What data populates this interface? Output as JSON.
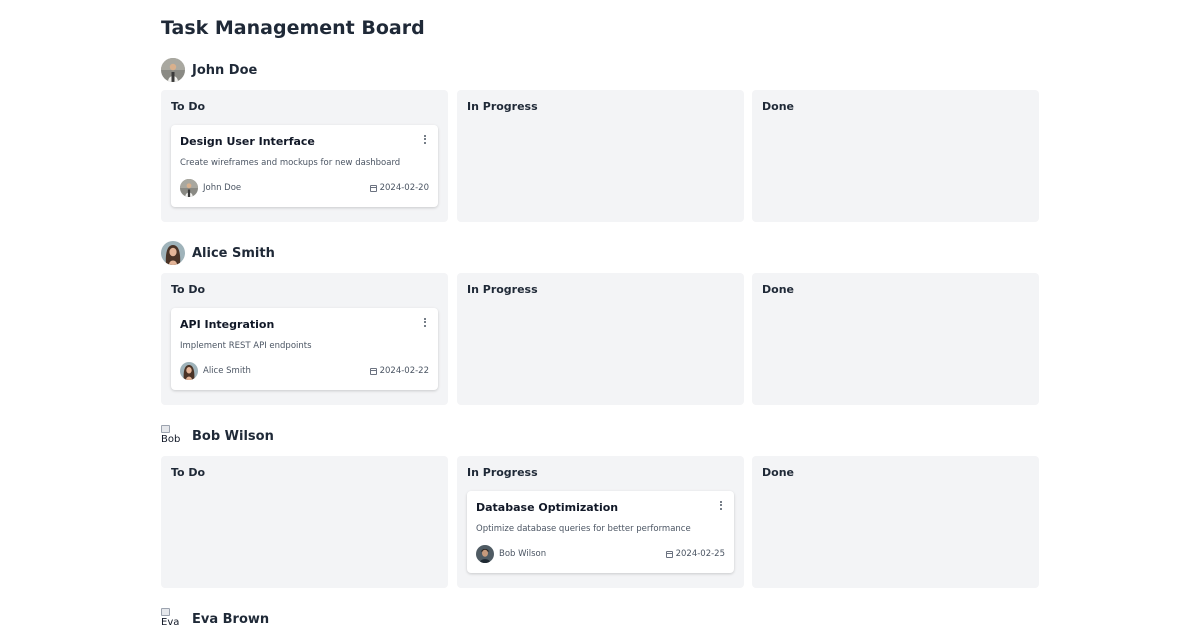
{
  "board": {
    "title": "Task Management Board"
  },
  "users": [
    {
      "name": "John Doe",
      "avatar": "person-photo-bald-man",
      "columns": [
        {
          "title": "To Do",
          "card": {
            "title": "Design User Interface",
            "description": "Create wireframes and mockups for new dashboard",
            "assignee": "John Doe",
            "due": "2024-02-20"
          }
        },
        {
          "title": "In Progress"
        },
        {
          "title": "Done"
        }
      ]
    },
    {
      "name": "Alice Smith",
      "avatar": "person-photo-woman",
      "columns": [
        {
          "title": "To Do",
          "card": {
            "title": "API Integration",
            "description": "Implement REST API endpoints",
            "assignee": "Alice Smith",
            "due": "2024-02-22"
          }
        },
        {
          "title": "In Progress"
        },
        {
          "title": "Done"
        }
      ]
    },
    {
      "name": "Bob Wilson",
      "avatar_alt": "Bob",
      "columns": [
        {
          "title": "To Do"
        },
        {
          "title": "In Progress",
          "card": {
            "title": "Database Optimization",
            "description": "Optimize database queries for better performance",
            "assignee": "Bob Wilson",
            "due": "2024-02-25"
          }
        },
        {
          "title": "Done"
        }
      ]
    },
    {
      "name": "Eva Brown",
      "avatar_alt": "Eva"
    }
  ],
  "colors": {
    "column_bg": "#f3f4f6",
    "card_bg": "#ffffff",
    "text_primary": "#1f2937",
    "text_secondary": "#4b5563"
  },
  "icons": {
    "card_menu": "more-vertical-icon",
    "due_date": "calendar-icon"
  }
}
